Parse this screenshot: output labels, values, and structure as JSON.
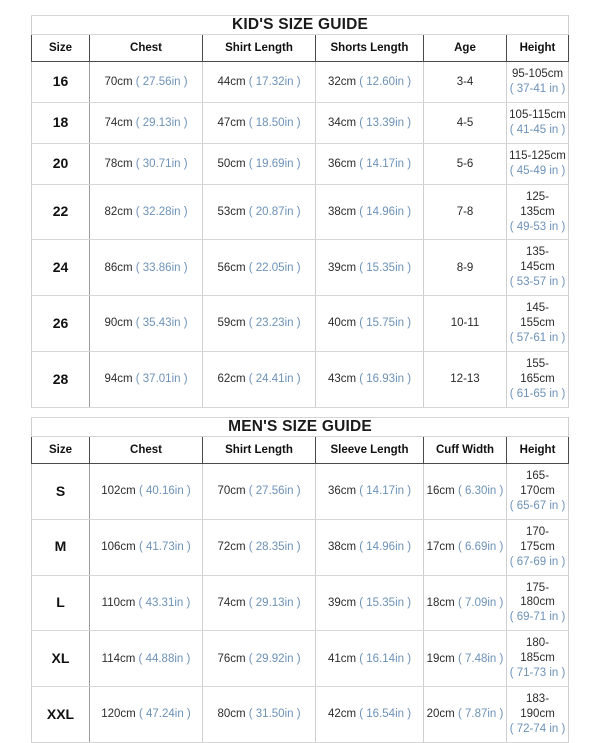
{
  "kids": {
    "banner": "KID'S SIZE GUIDE",
    "columns": [
      "Size",
      "Chest",
      "Shirt Length",
      "Shorts Length",
      "Age",
      "Height"
    ],
    "rows": [
      {
        "size": "16",
        "chest_cm": "70cm",
        "chest_in": "( 27.56in )",
        "shirt_cm": "44cm",
        "shirt_in": "( 17.32in )",
        "shorts_cm": "32cm",
        "shorts_in": "( 12.60in )",
        "age": "3-4",
        "height_cm": "95-105cm",
        "height_in": "( 37-41 in )"
      },
      {
        "size": "18",
        "chest_cm": "74cm",
        "chest_in": "( 29.13in )",
        "shirt_cm": "47cm",
        "shirt_in": "( 18.50in )",
        "shorts_cm": "34cm",
        "shorts_in": "( 13.39in )",
        "age": "4-5",
        "height_cm": "105-115cm",
        "height_in": "( 41-45 in )"
      },
      {
        "size": "20",
        "chest_cm": "78cm",
        "chest_in": "( 30.71in )",
        "shirt_cm": "50cm",
        "shirt_in": "( 19.69in )",
        "shorts_cm": "36cm",
        "shorts_in": "( 14.17in )",
        "age": "5-6",
        "height_cm": "115-125cm",
        "height_in": "( 45-49 in )"
      },
      {
        "size": "22",
        "chest_cm": "82cm",
        "chest_in": "( 32.28in )",
        "shirt_cm": "53cm",
        "shirt_in": "( 20.87in )",
        "shorts_cm": "38cm",
        "shorts_in": "( 14.96in )",
        "age": "7-8",
        "height_cm": "125-135cm",
        "height_in": "( 49-53 in )"
      },
      {
        "size": "24",
        "chest_cm": "86cm",
        "chest_in": "( 33.86in )",
        "shirt_cm": "56cm",
        "shirt_in": "( 22.05in )",
        "shorts_cm": "39cm",
        "shorts_in": "( 15.35in )",
        "age": "8-9",
        "height_cm": "135-145cm",
        "height_in": "( 53-57 in )"
      },
      {
        "size": "26",
        "chest_cm": "90cm",
        "chest_in": "( 35.43in )",
        "shirt_cm": "59cm",
        "shirt_in": "( 23.23in )",
        "shorts_cm": "40cm",
        "shorts_in": "( 15.75in )",
        "age": "10-11",
        "height_cm": "145-155cm",
        "height_in": "( 57-61 in )"
      },
      {
        "size": "28",
        "chest_cm": "94cm",
        "chest_in": "( 37.01in )",
        "shirt_cm": "62cm",
        "shirt_in": "( 24.41in )",
        "shorts_cm": "43cm",
        "shorts_in": "( 16.93in )",
        "age": "12-13",
        "height_cm": "155-165cm",
        "height_in": "( 61-65 in )"
      }
    ]
  },
  "mens": {
    "banner": "MEN'S SIZE GUIDE",
    "columns": [
      "Size",
      "Chest",
      "Shirt Length",
      "Sleeve Length",
      "Cuff Width",
      "Height"
    ],
    "rows": [
      {
        "size": "S",
        "chest_cm": "102cm",
        "chest_in": "( 40.16in )",
        "shirt_cm": "70cm",
        "shirt_in": "( 27.56in )",
        "sleeve_cm": "36cm",
        "sleeve_in": "( 14.17in )",
        "cuff_cm": "16cm",
        "cuff_in": "( 6.30in )",
        "height_cm": "165-170cm",
        "height_in": "( 65-67 in )"
      },
      {
        "size": "M",
        "chest_cm": "106cm",
        "chest_in": "( 41.73in )",
        "shirt_cm": "72cm",
        "shirt_in": "( 28.35in )",
        "sleeve_cm": "38cm",
        "sleeve_in": "( 14.96in )",
        "cuff_cm": "17cm",
        "cuff_in": "( 6.69in )",
        "height_cm": "170-175cm",
        "height_in": "( 67-69 in )"
      },
      {
        "size": "L",
        "chest_cm": "110cm",
        "chest_in": "( 43.31in )",
        "shirt_cm": "74cm",
        "shirt_in": "( 29.13in )",
        "sleeve_cm": "39cm",
        "sleeve_in": "( 15.35in )",
        "cuff_cm": "18cm",
        "cuff_in": "( 7.09in )",
        "height_cm": "175-180cm",
        "height_in": "( 69-71 in )"
      },
      {
        "size": "XL",
        "chest_cm": "114cm",
        "chest_in": "( 44.88in )",
        "shirt_cm": "76cm",
        "shirt_in": "( 29.92in )",
        "sleeve_cm": "41cm",
        "sleeve_in": "( 16.14in )",
        "cuff_cm": "19cm",
        "cuff_in": "( 7.48in )",
        "height_cm": "180-185cm",
        "height_in": "( 71-73 in )"
      },
      {
        "size": "XXL",
        "chest_cm": "120cm",
        "chest_in": "( 47.24in )",
        "shirt_cm": "80cm",
        "shirt_in": "( 31.50in )",
        "sleeve_cm": "42cm",
        "sleeve_in": "( 16.54in )",
        "cuff_cm": "20cm",
        "cuff_in": "( 7.87in )",
        "height_cm": "183-190cm",
        "height_in": "( 72-74 in )"
      }
    ]
  },
  "colors": {
    "kids_banner_bg": "#b9b9b9",
    "mens_banner_bg": "#d3d3d3",
    "metric_text": "#2c2c2c",
    "imperial_text": "#6d92b8",
    "border": "#3f3f3f"
  }
}
